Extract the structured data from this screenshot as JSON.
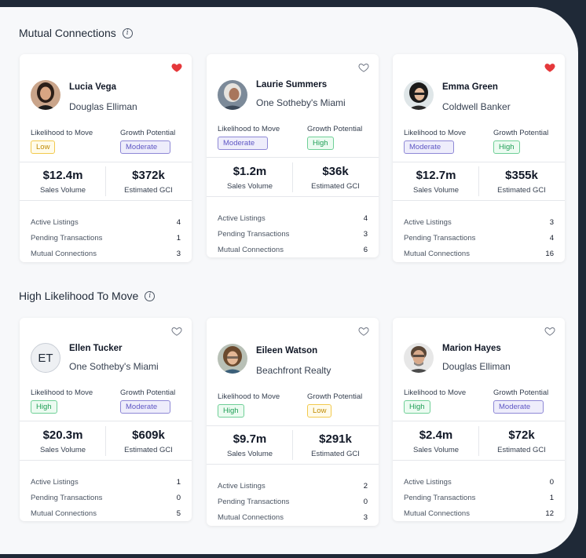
{
  "sections": [
    {
      "title": "Mutual Connections",
      "cards": [
        {
          "name": "Lucia Vega",
          "company": "Douglas Elliman",
          "favorited": true,
          "avatar": "photo-woman-dark-hair",
          "likelihood": "Low",
          "likelihood_level": "low",
          "growth": "Moderate",
          "growth_level": "moderate",
          "sales_volume": "$12.4m",
          "gci": "$372k",
          "active_listings": "4",
          "pending_transactions": "1",
          "mutual_connections": "3"
        },
        {
          "name": "Laurie Summers",
          "company": "One Sotheby's Miami",
          "favorited": false,
          "avatar": "photo-woman-white-hair",
          "likelihood": "Moderate",
          "likelihood_level": "moderate",
          "growth": "High",
          "growth_level": "high",
          "sales_volume": "$1.2m",
          "gci": "$36k",
          "active_listings": "4",
          "pending_transactions": "3",
          "mutual_connections": "6"
        },
        {
          "name": "Emma Green",
          "company": "Coldwell Banker",
          "favorited": true,
          "avatar": "photo-woman-glasses",
          "likelihood": "Moderate",
          "likelihood_level": "moderate",
          "growth": "High",
          "growth_level": "high",
          "sales_volume": "$12.7m",
          "gci": "$355k",
          "active_listings": "3",
          "pending_transactions": "4",
          "mutual_connections": "16"
        }
      ]
    },
    {
      "title": "High Likelihood To Move",
      "cards": [
        {
          "name": "Ellen Tucker",
          "company": "One Sotheby's Miami",
          "favorited": false,
          "avatar_initials": "ET",
          "likelihood": "High",
          "likelihood_level": "high",
          "growth": "Moderate",
          "growth_level": "moderate",
          "sales_volume": "$20.3m",
          "gci": "$609k",
          "active_listings": "1",
          "pending_transactions": "0",
          "mutual_connections": "5"
        },
        {
          "name": "Eileen Watson",
          "company": "Beachfront Realty",
          "favorited": false,
          "avatar": "photo-woman-curly-hair",
          "likelihood": "High",
          "likelihood_level": "high",
          "growth": "Low",
          "growth_level": "low",
          "sales_volume": "$9.7m",
          "gci": "$291k",
          "active_listings": "2",
          "pending_transactions": "0",
          "mutual_connections": "3"
        },
        {
          "name": "Marion Hayes",
          "company": "Douglas Elliman",
          "favorited": false,
          "avatar": "photo-man-glasses",
          "likelihood": "High",
          "likelihood_level": "high",
          "growth": "Moderate",
          "growth_level": "moderate",
          "sales_volume": "$2.4m",
          "gci": "$72k",
          "active_listings": "0",
          "pending_transactions": "1",
          "mutual_connections": "12"
        }
      ]
    }
  ],
  "labels": {
    "likelihood": "Likelihood to Move",
    "growth": "Growth Potential",
    "sales_volume": "Sales Volume",
    "gci": "Estimated GCI",
    "active_listings": "Active Listings",
    "pending_transactions": "Pending Transactions",
    "mutual_connections": "Mutual Connections"
  },
  "colors": {
    "heart_filled": "#e5383b",
    "heart_outline": "#6b7280",
    "page_background": "#f7f8fa",
    "frame": "#1f2937"
  }
}
